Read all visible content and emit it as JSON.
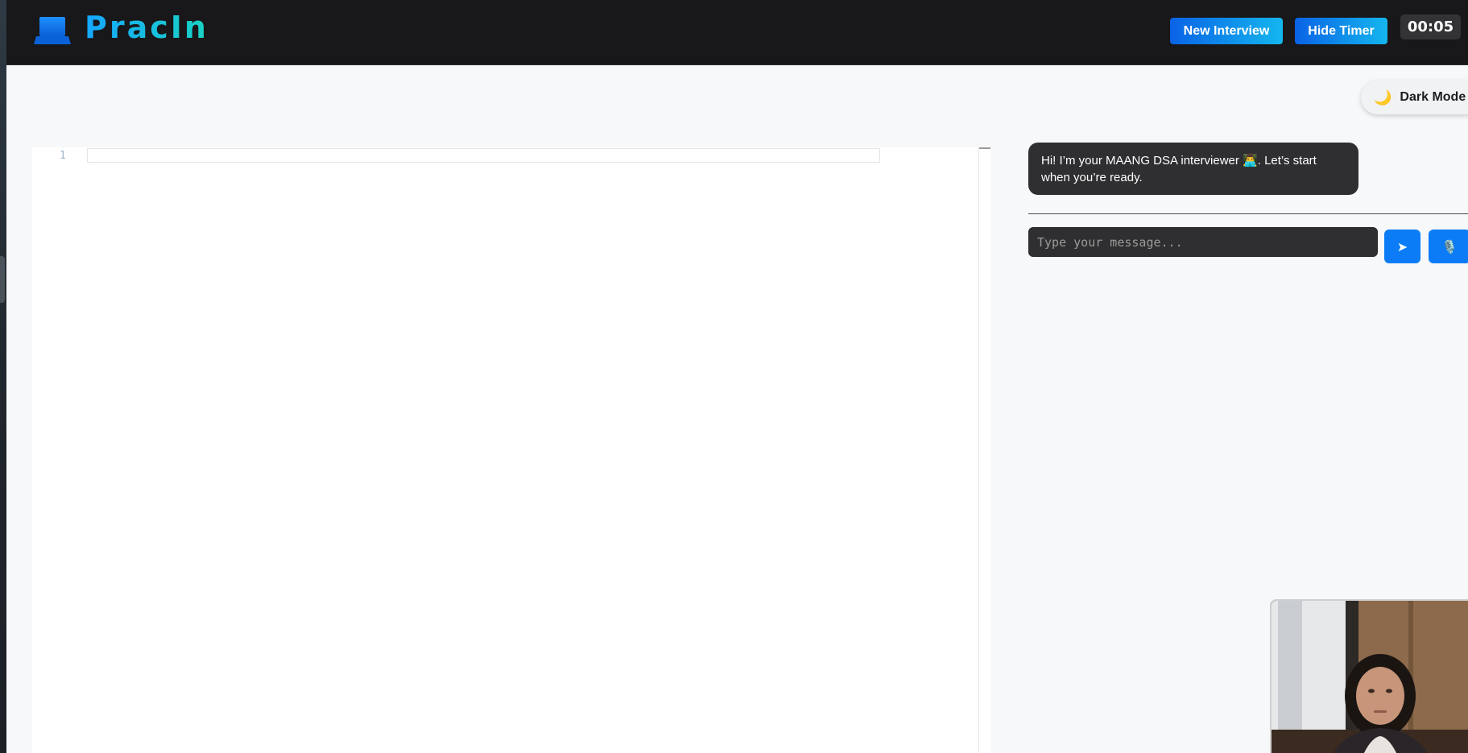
{
  "header": {
    "logo_text": "PracIn",
    "new_interview_label": "New Interview",
    "hide_timer_label": "Hide Timer",
    "timer": "00:05",
    "logo_icon": "laptop-icon",
    "colors": {
      "background": "#181719",
      "button_start": "#0a63e6",
      "button_end": "#14b6ee",
      "logo_start": "#16a7ff",
      "logo_end": "#19d3c2"
    }
  },
  "theme_toggle": {
    "label": "Dark Mode",
    "icon": "moon-icon",
    "glyph": "🌙"
  },
  "editor": {
    "line_numbers": [
      "1"
    ],
    "content": ""
  },
  "chat": {
    "messages": [
      {
        "role": "interviewer",
        "text": "Hi! I’m your MAANG DSA interviewer 👨‍💻. Let’s start when you’re ready."
      }
    ],
    "input_placeholder": "Type your message...",
    "send_glyph": "➤",
    "send_icon": "send-arrow-icon",
    "mic_glyph": "🎙️",
    "mic_icon": "microphone-icon",
    "accent": "#0b7cf6"
  },
  "webcam": {
    "icon": "webcam-preview"
  }
}
